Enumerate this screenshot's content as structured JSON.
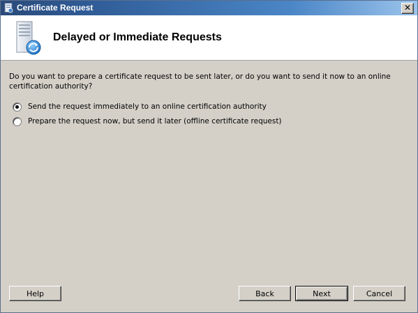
{
  "window": {
    "title": "Certificate Request",
    "close_glyph": "✕"
  },
  "header": {
    "title": "Delayed or Immediate Requests",
    "icon": "certificate-server-icon"
  },
  "question": "Do you want to prepare a certificate request to be sent later, or do you want to send it now to an online certification authority?",
  "options": [
    {
      "label": "Send the request immediately to an online certification authority",
      "checked": true
    },
    {
      "label": "Prepare the request now, but send it later (offline certificate request)",
      "checked": false
    }
  ],
  "buttons": {
    "help": "Help",
    "back": "Back",
    "next": "Next",
    "cancel": "Cancel"
  }
}
